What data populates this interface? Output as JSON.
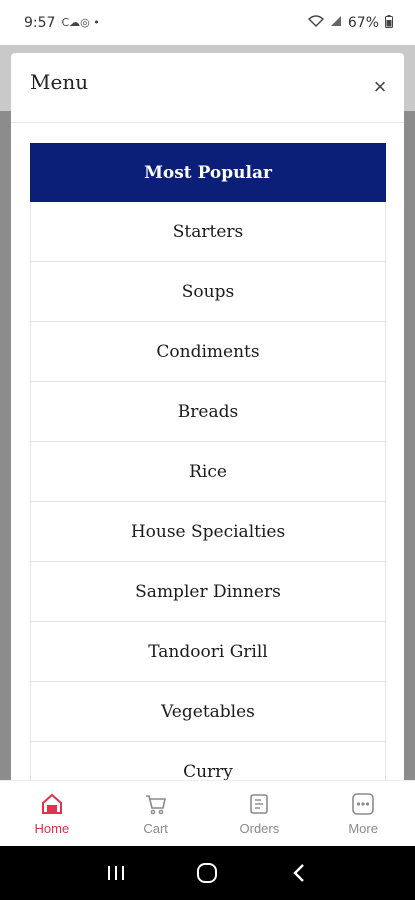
{
  "status_bar": {
    "time": "9:57",
    "left_icons": "С☁◎ •",
    "battery": "67%"
  },
  "modal": {
    "title": "Menu",
    "close_label": "×"
  },
  "categories": [
    {
      "label": "Most Popular",
      "active": true
    },
    {
      "label": "Starters"
    },
    {
      "label": "Soups"
    },
    {
      "label": "Condiments"
    },
    {
      "label": "Breads"
    },
    {
      "label": "Rice"
    },
    {
      "label": "House Specialties"
    },
    {
      "label": "Sampler Dinners"
    },
    {
      "label": "Tandoori Grill"
    },
    {
      "label": "Vegetables"
    },
    {
      "label": "Curry"
    }
  ],
  "bottom_nav": {
    "items": [
      {
        "label": "Home",
        "icon": "home-icon",
        "active": true
      },
      {
        "label": "Cart",
        "icon": "cart-icon"
      },
      {
        "label": "Orders",
        "icon": "orders-icon"
      },
      {
        "label": "More",
        "icon": "more-icon"
      }
    ]
  },
  "colors": {
    "accent": "#e0324b",
    "active_category_bg": "#0b1f78"
  }
}
